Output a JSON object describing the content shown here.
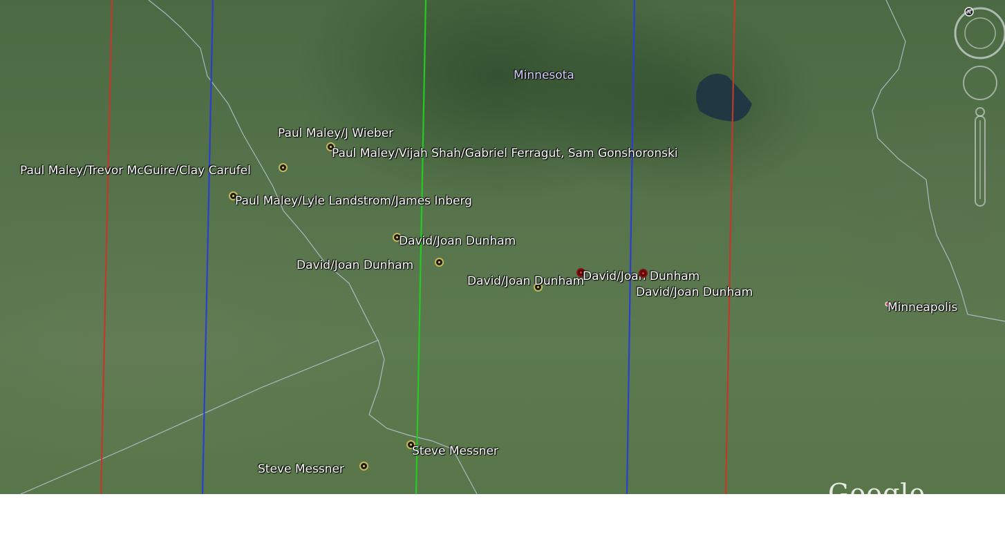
{
  "map": {
    "region_label": "Minnesota",
    "city_label": "Minneapolis",
    "watermark": "Google earth",
    "colors": {
      "limit_line": "#c0392b",
      "inner_line": "#2a3fd0",
      "center_line": "#22cc22",
      "border_line": "#b9c7d6",
      "pin_normal": "#c9b85a",
      "pin_selected": "#8a1010"
    }
  },
  "placemarks": [
    {
      "label": "Paul Maley/J Wieber",
      "selected": false
    },
    {
      "label": "Paul Maley/Vijah Shah/Gabriel Ferragut, Sam Gonshoronski",
      "selected": false
    },
    {
      "label": "Paul Maley/Trevor McGuire/Clay Carufel",
      "selected": false
    },
    {
      "label": "Paul Maley/Lyle Landstrom/James Inberg",
      "selected": false
    },
    {
      "label": "David/Joan Dunham",
      "selected": false
    },
    {
      "label": "David/Joan Dunham",
      "selected": false
    },
    {
      "label": "David/Joan Dunham",
      "selected": false
    },
    {
      "label": "David/Joan Dunham",
      "selected": true
    },
    {
      "label": "David/Joan Dunham",
      "selected": true
    },
    {
      "label": "Steve Messner",
      "selected": false
    },
    {
      "label": "Steve Messner",
      "selected": false
    }
  ],
  "navigation": {
    "north_icon": "north-indicator-icon",
    "look_icon": "look-joystick-icon",
    "move_icon": "move-joystick-icon",
    "zoom_icon": "zoom-slider-icon"
  }
}
